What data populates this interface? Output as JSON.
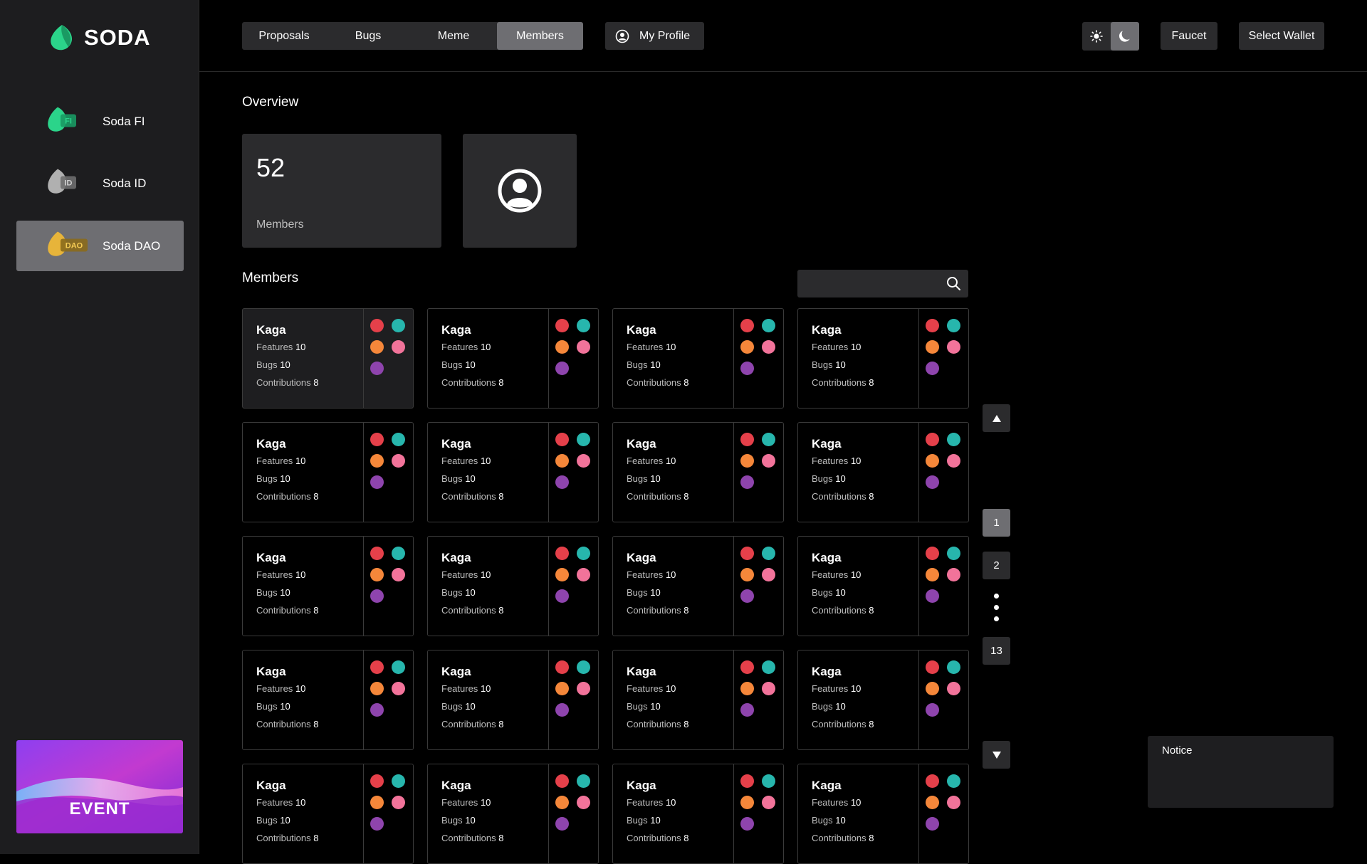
{
  "brand": {
    "name": "SODA",
    "accent": "#2bd48a"
  },
  "sidebar": {
    "items": [
      {
        "label": "Soda FI",
        "badge": "FI",
        "color": "#2bd48a"
      },
      {
        "label": "Soda ID",
        "badge": "ID",
        "color": "#9a9a9a"
      },
      {
        "label": "Soda DAO",
        "badge": "DAO",
        "color": "#e7b43a"
      }
    ],
    "event_label": "EVENT"
  },
  "header": {
    "tabs": [
      "Proposals",
      "Bugs",
      "Meme",
      "Members"
    ],
    "active_tab": "Members",
    "profile_label": "My Profile",
    "theme": "dark",
    "faucet_label": "Faucet",
    "wallet_label": "Select Wallet"
  },
  "overview": {
    "title": "Overview",
    "members_count": "52",
    "members_label": "Members"
  },
  "members": {
    "title": "Members",
    "search_placeholder": "",
    "features_label": "Features",
    "bugs_label": "Bugs",
    "contributions_label": "Contributions",
    "badge_colors": [
      "#e5404a",
      "#27b6ad",
      "#f5873a",
      "#f2739a",
      "#8e44ad"
    ],
    "cards": [
      {
        "name": "Kaga",
        "features": "10",
        "bugs": "10",
        "contributions": "8"
      },
      {
        "name": "Kaga",
        "features": "10",
        "bugs": "10",
        "contributions": "8"
      },
      {
        "name": "Kaga",
        "features": "10",
        "bugs": "10",
        "contributions": "8"
      },
      {
        "name": "Kaga",
        "features": "10",
        "bugs": "10",
        "contributions": "8"
      },
      {
        "name": "Kaga",
        "features": "10",
        "bugs": "10",
        "contributions": "8"
      },
      {
        "name": "Kaga",
        "features": "10",
        "bugs": "10",
        "contributions": "8"
      },
      {
        "name": "Kaga",
        "features": "10",
        "bugs": "10",
        "contributions": "8"
      },
      {
        "name": "Kaga",
        "features": "10",
        "bugs": "10",
        "contributions": "8"
      },
      {
        "name": "Kaga",
        "features": "10",
        "bugs": "10",
        "contributions": "8"
      },
      {
        "name": "Kaga",
        "features": "10",
        "bugs": "10",
        "contributions": "8"
      },
      {
        "name": "Kaga",
        "features": "10",
        "bugs": "10",
        "contributions": "8"
      },
      {
        "name": "Kaga",
        "features": "10",
        "bugs": "10",
        "contributions": "8"
      },
      {
        "name": "Kaga",
        "features": "10",
        "bugs": "10",
        "contributions": "8"
      },
      {
        "name": "Kaga",
        "features": "10",
        "bugs": "10",
        "contributions": "8"
      },
      {
        "name": "Kaga",
        "features": "10",
        "bugs": "10",
        "contributions": "8"
      },
      {
        "name": "Kaga",
        "features": "10",
        "bugs": "10",
        "contributions": "8"
      },
      {
        "name": "Kaga",
        "features": "10",
        "bugs": "10",
        "contributions": "8"
      },
      {
        "name": "Kaga",
        "features": "10",
        "bugs": "10",
        "contributions": "8"
      },
      {
        "name": "Kaga",
        "features": "10",
        "bugs": "10",
        "contributions": "8"
      },
      {
        "name": "Kaga",
        "features": "10",
        "bugs": "10",
        "contributions": "8"
      }
    ]
  },
  "pagination": {
    "pages": [
      "1",
      "2",
      "13"
    ],
    "current": "1",
    "up_icon": "triangle-up-icon",
    "down_icon": "triangle-down-icon"
  },
  "notice": {
    "title": "Notice"
  }
}
